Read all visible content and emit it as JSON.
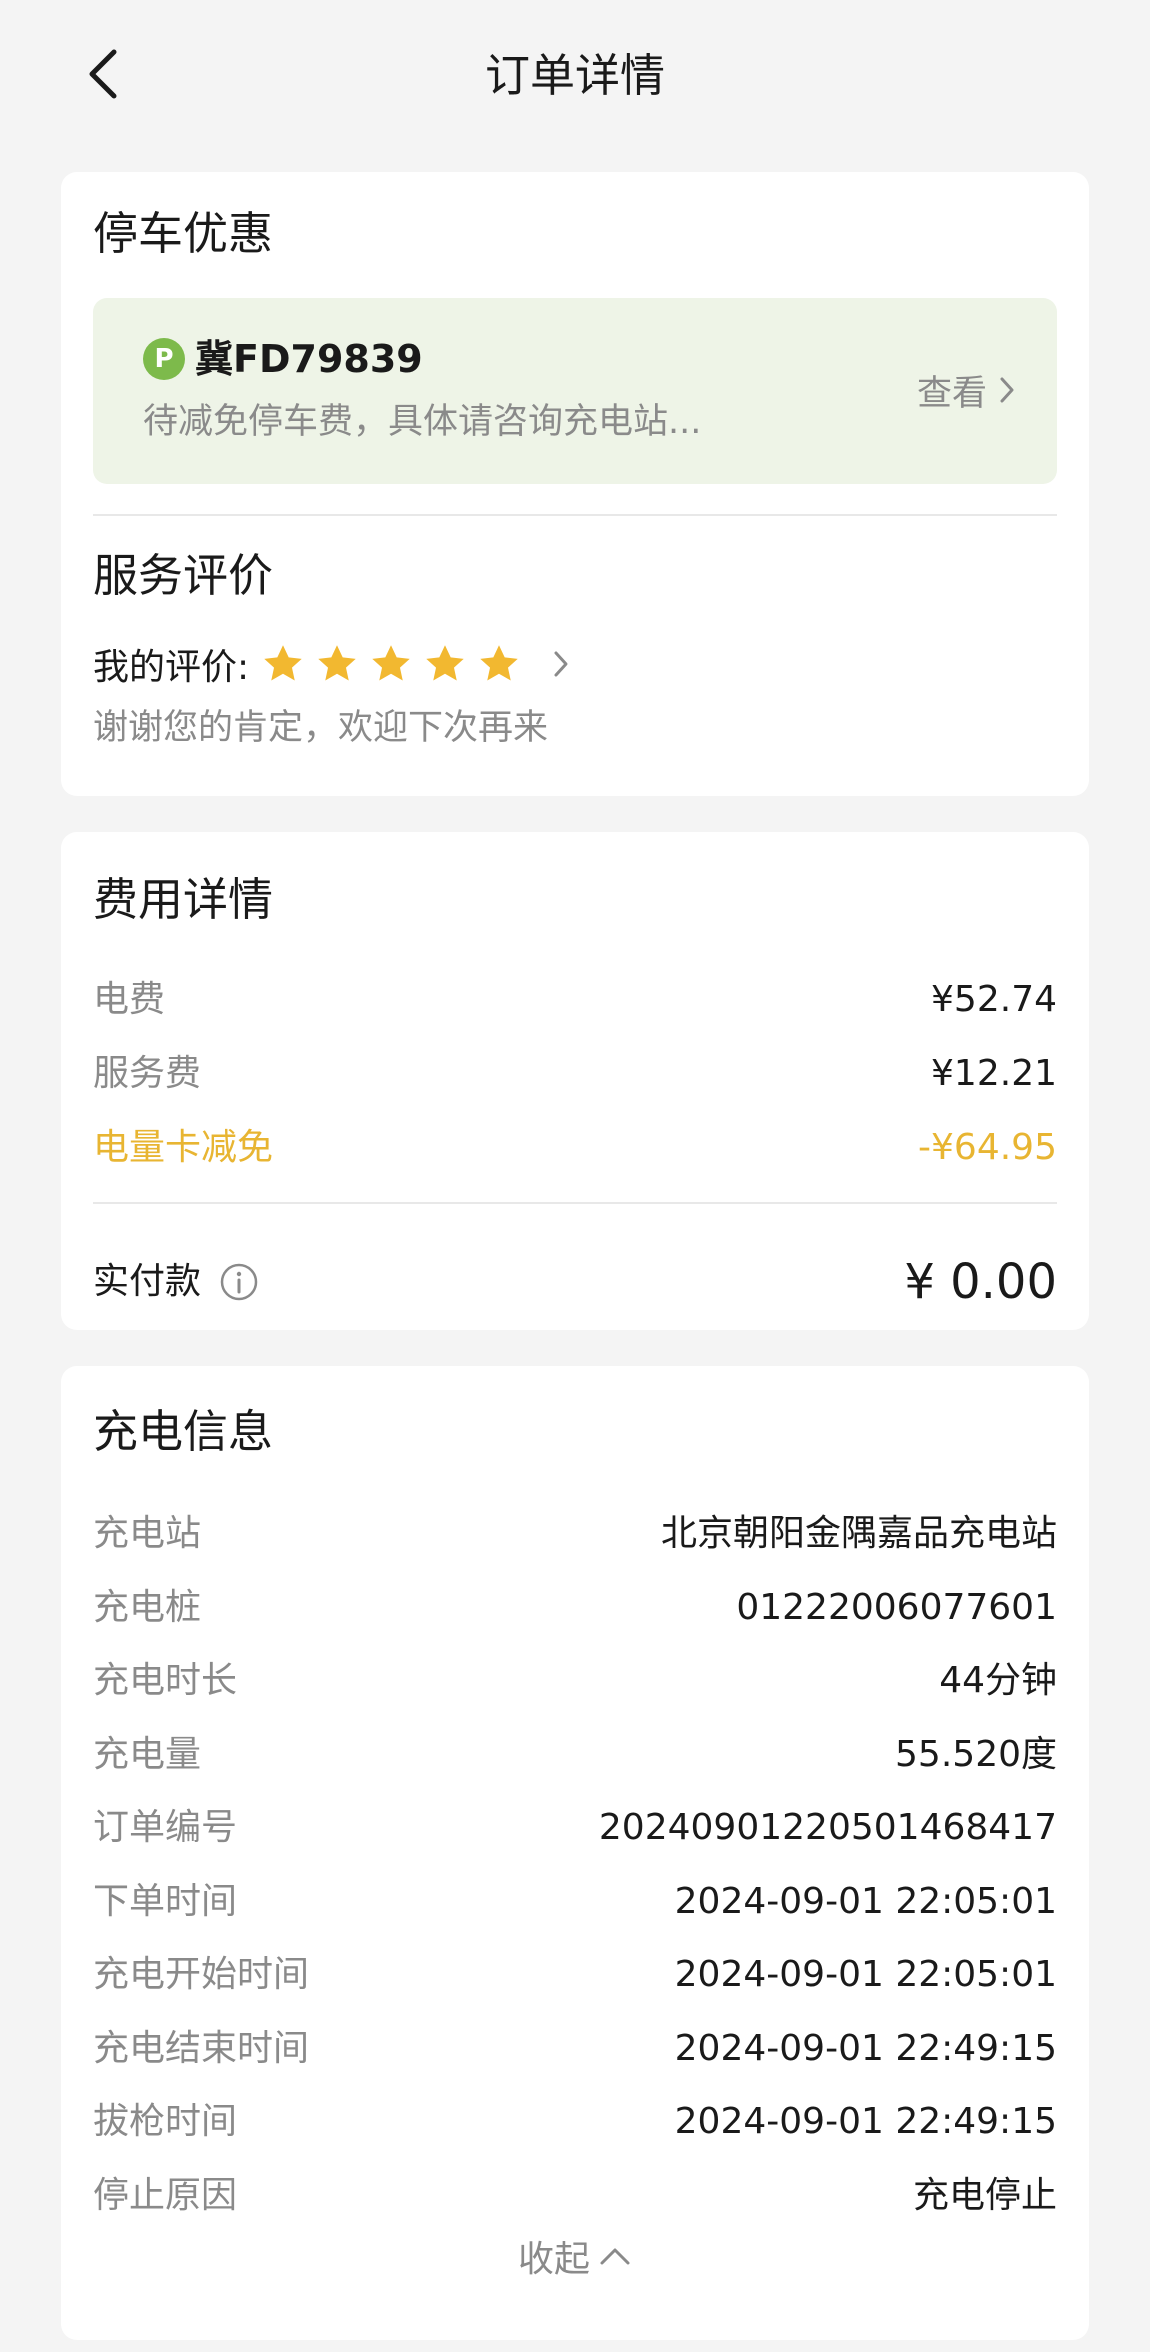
{
  "header": {
    "title": "订单详情"
  },
  "parking": {
    "title": "停车优惠",
    "badge": "P",
    "plate": "冀FD79839",
    "desc": "待减免停车费，具体请咨询充电站...",
    "view_label": "查看"
  },
  "rating": {
    "title": "服务评价",
    "label": "我的评价:",
    "stars": 5,
    "thanks": "谢谢您的肯定，欢迎下次再来"
  },
  "fees": {
    "title": "费用详情",
    "items": [
      {
        "label": "电费",
        "value": "¥52.74"
      },
      {
        "label": "服务费",
        "value": "¥12.21"
      },
      {
        "label": "电量卡减免",
        "value": "-¥64.95"
      }
    ],
    "paid_label": "实付款",
    "paid_value": "¥ 0.00"
  },
  "charging": {
    "title": "充电信息",
    "rows": [
      {
        "label": "充电站",
        "value": "北京朝阳金隅嘉品充电站"
      },
      {
        "label": "充电桩",
        "value": "01222006077601"
      },
      {
        "label": "充电时长",
        "value": "44分钟"
      },
      {
        "label": "充电量",
        "value": "55.520度"
      },
      {
        "label": "订单编号",
        "value": "20240901220501468417"
      },
      {
        "label": "下单时间",
        "value": "2024-09-01 22:05:01"
      },
      {
        "label": "充电开始时间",
        "value": "2024-09-01 22:05:01"
      },
      {
        "label": "充电结束时间",
        "value": "2024-09-01 22:49:15"
      },
      {
        "label": "拔枪时间",
        "value": "2024-09-01 22:49:15"
      },
      {
        "label": "停止原因",
        "value": "充电停止"
      }
    ],
    "collapse_label": "收起"
  },
  "colors": {
    "accent": "#e8b532",
    "badge": "#7dba4b",
    "promo_bg": "#eef4e7"
  }
}
